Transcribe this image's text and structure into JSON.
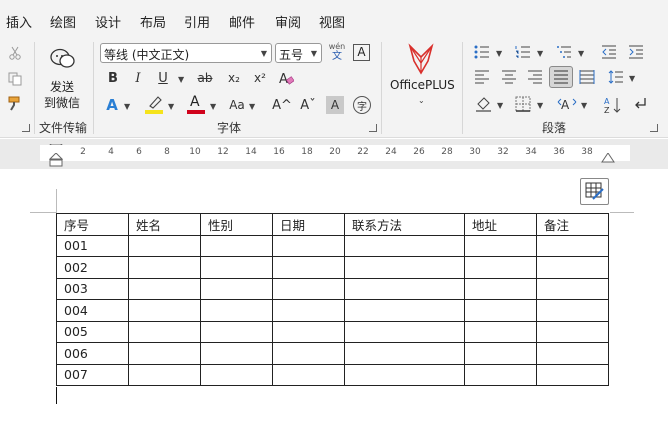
{
  "menu": [
    "插入",
    "绘图",
    "设计",
    "布局",
    "引用",
    "邮件",
    "审阅",
    "视图"
  ],
  "ribbon": {
    "file_transfer": {
      "button_line1": "发送",
      "button_line2": "到微信",
      "group_label": "文件传输"
    },
    "font": {
      "family": "等线 (中文正文)",
      "size": "五号",
      "phonetic_top": "wén",
      "phonetic_bottom": "文",
      "char_border": "A",
      "bold": "B",
      "italic": "I",
      "underline": "U",
      "strike": "ab",
      "subscript": "x₂",
      "superscript": "x²",
      "text_effect": "A",
      "font_color": "A",
      "change_case": "Aa",
      "grow_font": "A^",
      "shrink_font": "Aˇ",
      "char_shading": "A",
      "enclose_char": "字",
      "group_label": "字体",
      "highlight_color": "#f5e31b",
      "font_color_value": "#d0021b"
    },
    "officeplus": {
      "label": "OfficePLUS"
    },
    "paragraph": {
      "group_label": "段落"
    }
  },
  "ruler": {
    "marks": [
      "2",
      "4",
      "6",
      "8",
      "10",
      "12",
      "14",
      "16",
      "18",
      "20",
      "22",
      "24",
      "26",
      "28",
      "30",
      "32",
      "34",
      "36",
      "38"
    ]
  },
  "table": {
    "headers": [
      "序号",
      "姓名",
      "性别",
      "日期",
      "联系方法",
      "地址",
      "备注"
    ],
    "rows": [
      [
        "001",
        "",
        "",
        "",
        "",
        "",
        ""
      ],
      [
        "002",
        "",
        "",
        "",
        "",
        "",
        ""
      ],
      [
        "003",
        "",
        "",
        "",
        "",
        "",
        ""
      ],
      [
        "004",
        "",
        "",
        "",
        "",
        "",
        ""
      ],
      [
        "005",
        "",
        "",
        "",
        "",
        "",
        ""
      ],
      [
        "006",
        "",
        "",
        "",
        "",
        "",
        ""
      ],
      [
        "007",
        "",
        "",
        "",
        "",
        "",
        ""
      ]
    ]
  }
}
